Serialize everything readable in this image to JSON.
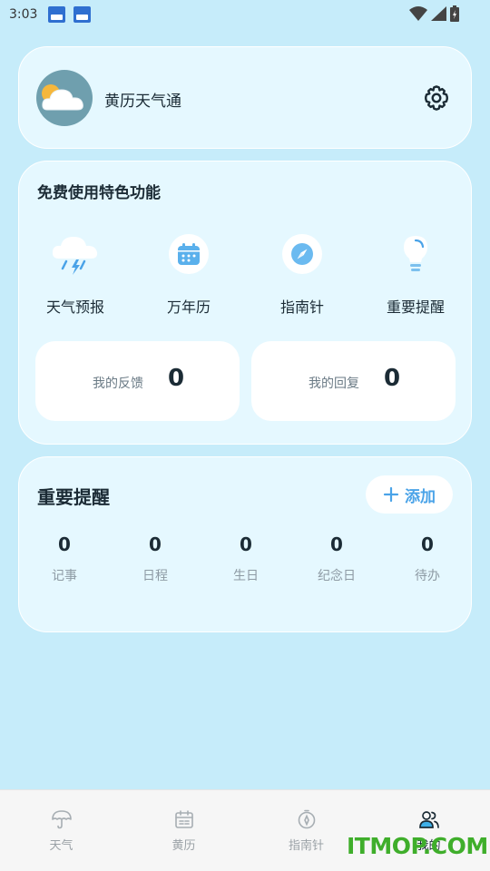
{
  "status_bar": {
    "time": "3:03"
  },
  "profile": {
    "app_name": "黄历天气通"
  },
  "features": {
    "title": "免费使用特色功能",
    "items": [
      {
        "label": "天气预报",
        "icon": "storm-cloud-icon"
      },
      {
        "label": "万年历",
        "icon": "calendar-icon"
      },
      {
        "label": "指南针",
        "icon": "compass-icon"
      },
      {
        "label": "重要提醒",
        "icon": "lightbulb-icon"
      }
    ],
    "feedback": {
      "label": "我的反馈",
      "value": "0"
    },
    "replies": {
      "label": "我的回复",
      "value": "0"
    }
  },
  "reminders": {
    "title": "重要提醒",
    "add_label": "添加",
    "counts": [
      {
        "value": "0",
        "label": "记事"
      },
      {
        "value": "0",
        "label": "日程"
      },
      {
        "value": "0",
        "label": "生日"
      },
      {
        "value": "0",
        "label": "纪念日"
      },
      {
        "value": "0",
        "label": "待办"
      }
    ]
  },
  "nav": {
    "items": [
      {
        "label": "天气",
        "icon": "umbrella-icon",
        "active": false
      },
      {
        "label": "黄历",
        "icon": "calendar-icon",
        "active": false
      },
      {
        "label": "指南针",
        "icon": "compass-icon",
        "active": false
      },
      {
        "label": "我的",
        "icon": "users-icon",
        "active": true
      }
    ]
  },
  "watermark": "ITMOP.COM",
  "colors": {
    "background": "#c6ecfa",
    "accent": "#4aa3e8",
    "text": "#1b2b35"
  }
}
